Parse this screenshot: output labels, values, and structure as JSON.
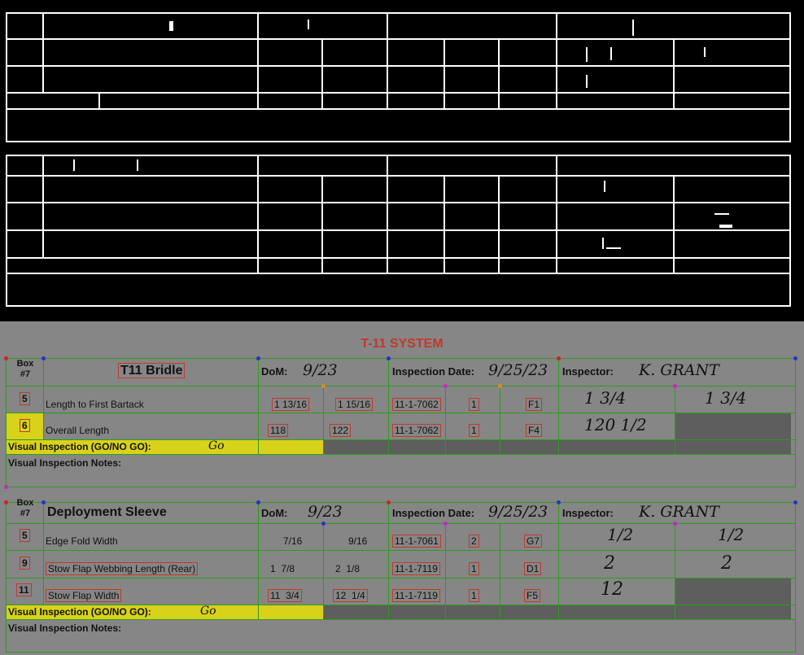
{
  "system_title": "T-11 SYSTEM",
  "headers": {
    "box": "Box",
    "num": "#7",
    "dom": "DoM:",
    "insp_date": "Inspection Date:",
    "inspector": "Inspector:"
  },
  "visual_go": "Visual Inspection (GO/NO GO):",
  "visual_notes": "Visual Inspection Notes:",
  "section1": {
    "name": "T11 Bridle",
    "dom_value": "9/23",
    "insp_date_value": "9/25/23",
    "inspector_value": "K. GRANT",
    "go_value": "Go",
    "rows": [
      {
        "box": "5",
        "desc": "Length to First Bartack",
        "min": "1 13/16",
        "max": "1 15/16",
        "part": "11-1-7062",
        "qty": "1",
        "loc": "F1",
        "m1": "1 3/4",
        "m2": "1 3/4"
      },
      {
        "box": "6",
        "desc": "Overall Length",
        "min": "118",
        "max": "122",
        "part": "11-1-7062",
        "qty": "1",
        "loc": "F4",
        "m1": "120 1/2",
        "m2": ""
      }
    ]
  },
  "section2": {
    "name": "Deployment Sleeve",
    "dom_value": "9/23",
    "insp_date_value": "9/25/23",
    "inspector_value": "K. GRANT",
    "go_value": "Go",
    "rows": [
      {
        "box": "5",
        "desc": "Edge Fold Width",
        "min": "7/16",
        "max": "9/16",
        "part": "11-1-7061",
        "qty": "2",
        "loc": "G7",
        "m1": "1/2",
        "m2": "1/2"
      },
      {
        "box": "9",
        "desc": "Stow Flap Webbing Length (Rear)",
        "min": "1  7/8",
        "max": "2  1/8",
        "part": "11-1-7119",
        "qty": "1",
        "loc": "D1",
        "m1": "2",
        "m2": "2"
      },
      {
        "box": "11",
        "desc": "Stow Flap Width",
        "min": "11  3/4",
        "max": "12  1/4",
        "part": "11-1-7119",
        "qty": "1",
        "loc": "F5",
        "m1": "12",
        "m2": ""
      }
    ]
  }
}
